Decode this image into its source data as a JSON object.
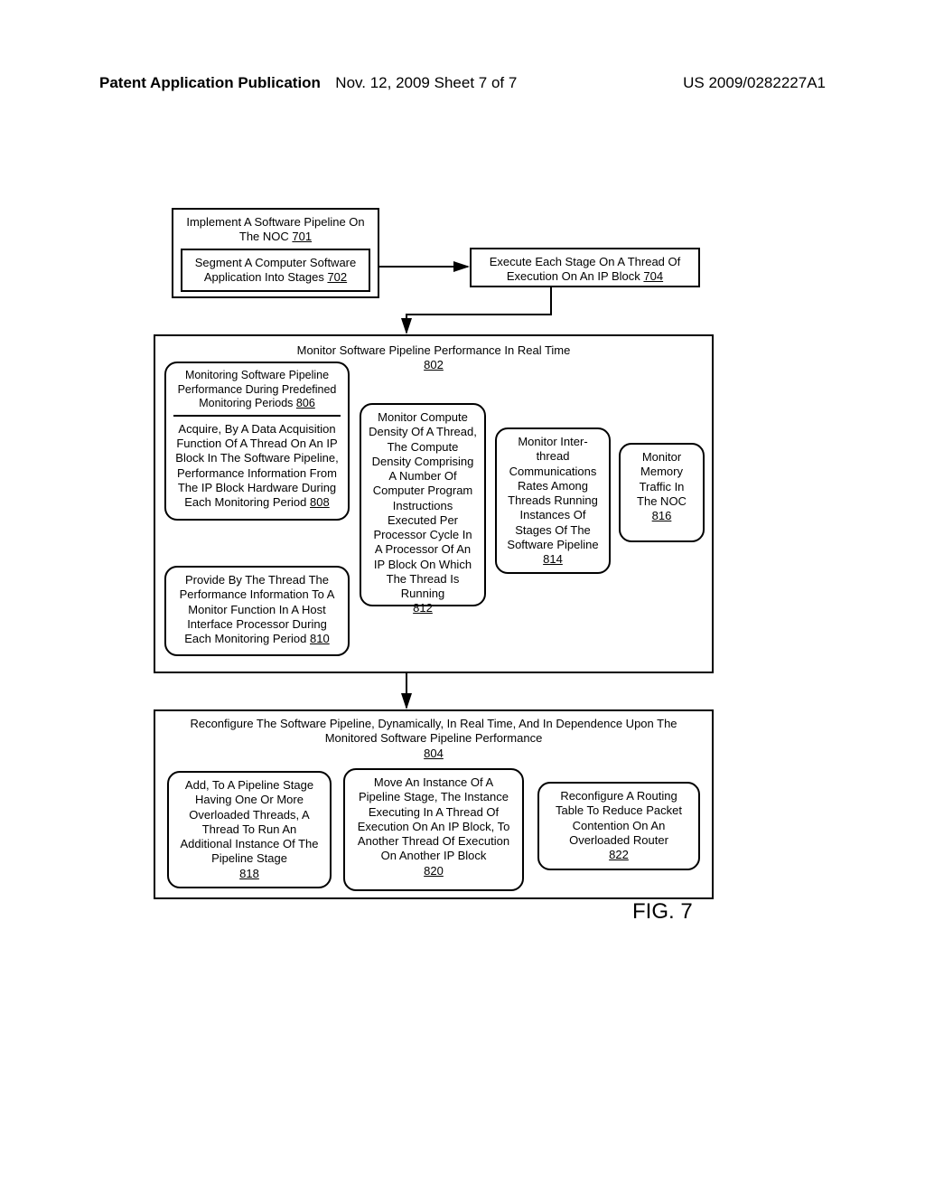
{
  "header": {
    "left": "Patent Application Publication",
    "center": "Nov. 12, 2009  Sheet 7 of 7",
    "right": "US 2009/0282227A1"
  },
  "figure": {
    "label": "FIG. 7"
  },
  "boxes": {
    "b701": {
      "title": "Implement A Software Pipeline On The NOC ",
      "ref": "701",
      "b702": {
        "text": "Segment A Computer Software Application Into Stages ",
        "ref": "702"
      }
    },
    "b704": {
      "text": "Execute Each Stage On A Thread Of Execution On An IP Block ",
      "ref": "704"
    },
    "b802": {
      "title": "Monitor Software Pipeline Performance In Real Time",
      "ref": "802",
      "b806_title": "Monitoring Software Pipeline Performance During Predefined Monitoring Periods ",
      "b806_ref": "806",
      "b808": {
        "text": "Acquire, By A Data Acquisition Function Of A Thread On An IP Block In The Software Pipeline, Performance Information From The IP Block Hardware During Each Monitoring Period ",
        "ref": "808"
      },
      "b810": {
        "text": "Provide By The Thread The Performance Information To A Monitor Function In A Host Interface Processor During Each Monitoring Period ",
        "ref": "810"
      },
      "c812": {
        "text": "Monitor Compute Density Of A Thread, The Compute Density Comprising A Number Of Computer Program Instructions Executed Per Processor Cycle In A Processor Of An IP Block On Which The Thread Is Running",
        "ref": "812"
      },
      "c814": {
        "text": "Monitor Inter-thread Communications Rates Among Threads Running Instances Of Stages Of The Software Pipeline",
        "ref": "814"
      },
      "c816": {
        "text": "Monitor Memory Traffic In The NOC",
        "ref": "816"
      }
    },
    "b804": {
      "title": "Reconfigure The Software Pipeline, Dynamically, In Real Time, And In Dependence Upon The Monitored Software Pipeline Performance",
      "ref": "804",
      "c818": {
        "text": "Add, To A Pipeline Stage Having One Or More Overloaded Threads, A Thread To Run An Additional Instance Of The Pipeline Stage",
        "ref": "818"
      },
      "c820": {
        "text": "Move An Instance Of A Pipeline Stage, The Instance Executing In A Thread Of Execution On An IP Block, To Another Thread Of Execution On Another IP Block",
        "ref": "820"
      },
      "c822": {
        "text": "Reconfigure A Routing Table To Reduce Packet Contention On An Overloaded Router",
        "ref": "822"
      }
    }
  }
}
